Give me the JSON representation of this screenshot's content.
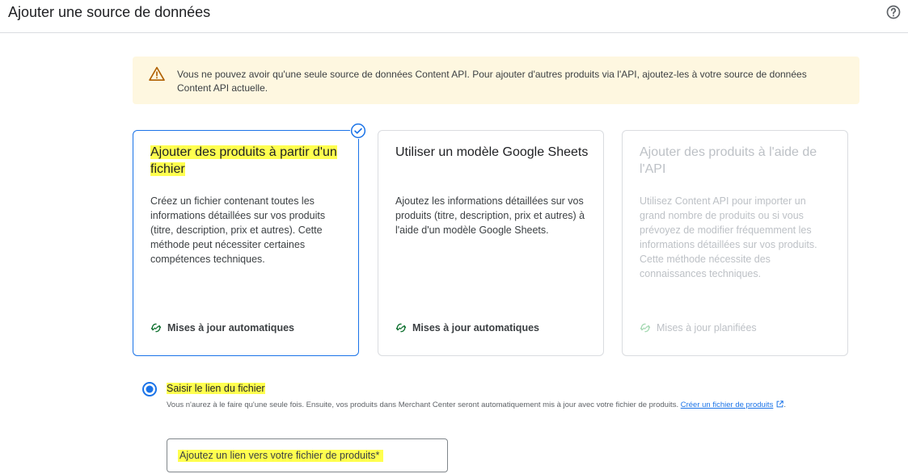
{
  "header": {
    "title": "Ajouter une source de données",
    "help_icon": "help-circle-icon"
  },
  "warning": {
    "icon": "warning-triangle-icon",
    "text": "Vous ne pouvez avoir qu'une seule source de données Content API. Pour ajouter d'autres produits via l'API, ajoutez-les à votre source de données Content API actuelle.",
    "background": "#fef7e0"
  },
  "cards": [
    {
      "title": "Ajouter des produits à partir d'un fichier",
      "description": "Créez un fichier contenant toutes les informations détaillées sur vos produits (titre, description, prix et autres). Cette méthode peut nécessiter certaines compétences techniques.",
      "feature": "Mises à jour automatiques",
      "feature_icon": "sync-icon",
      "state": "selected",
      "badge_icon": "check-circle-icon"
    },
    {
      "title": "Utiliser un modèle Google Sheets",
      "description": "Ajoutez les informations détaillées sur vos produits (titre, description, prix et autres) à l'aide d'un modèle Google Sheets.",
      "feature": "Mises à jour automatiques",
      "feature_icon": "sync-icon",
      "state": "default"
    },
    {
      "title": "Ajouter des produits à l'aide de l'API",
      "description": "Utilisez Content API pour importer un grand nombre de produits ou si vous prévoyez de modifier fréquemment les informations détaillées sur vos produits. Cette méthode nécessite des connaissances techniques.",
      "feature": "Mises à jour planifiées",
      "feature_icon": "sync-icon",
      "state": "disabled"
    }
  ],
  "file_link_option": {
    "label": "Saisir le lien du fichier",
    "selected": true,
    "help_text": "Vous n'aurez à le faire qu'une seule fois. Ensuite, vos produits dans Merchant Center seront automatiquement mis à jour avec votre fichier de produits.",
    "link_text": "Créer un fichier de produits",
    "link_icon": "open-in-new-icon",
    "help_suffix": "."
  },
  "url_input": {
    "placeholder": "Ajoutez un lien vers votre fichier de produits*",
    "value": ""
  },
  "colors": {
    "accent": "#1a73e8",
    "highlight": "#ffff4f",
    "warning_icon": "#b06000",
    "feature_icon": "#137333"
  }
}
